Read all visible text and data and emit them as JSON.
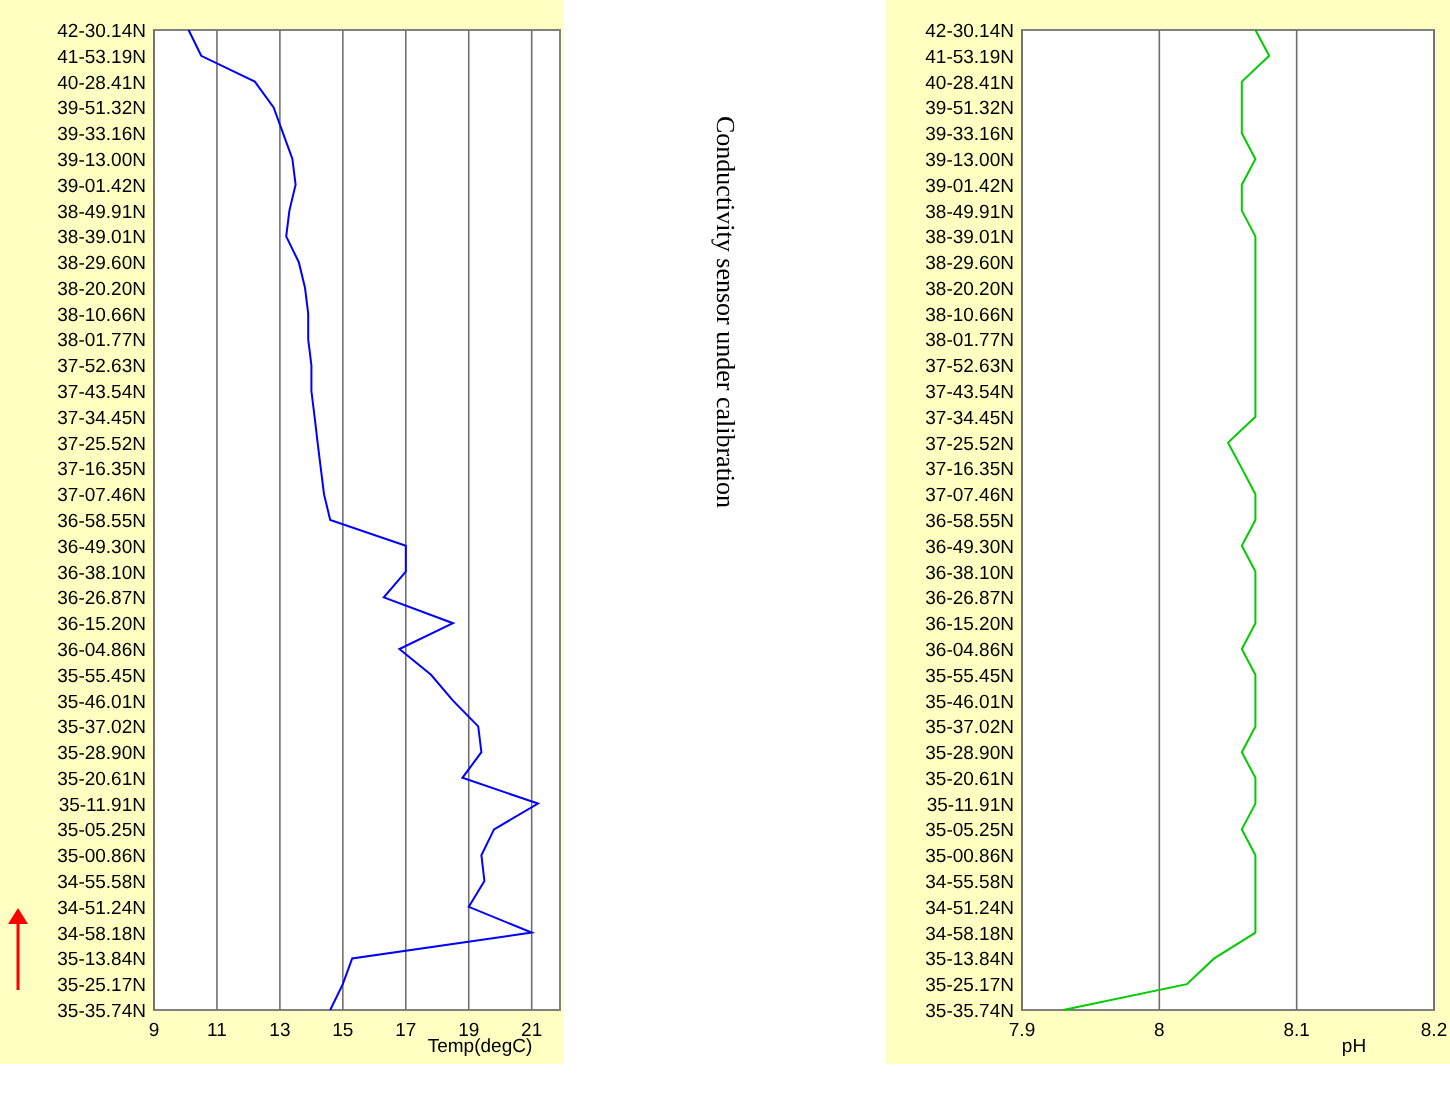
{
  "charts": [
    {
      "chart_data": {
        "type": "line",
        "orientation": "horizontal",
        "xlabel": "Temp(degC)",
        "categories": [
          "42-30.14N",
          "41-53.19N",
          "40-28.41N",
          "39-51.32N",
          "39-33.16N",
          "39-13.00N",
          "39-01.42N",
          "38-49.91N",
          "38-39.01N",
          "38-29.60N",
          "38-20.20N",
          "38-10.66N",
          "38-01.77N",
          "37-52.63N",
          "37-43.54N",
          "37-34.45N",
          "37-25.52N",
          "37-16.35N",
          "37-07.46N",
          "36-58.55N",
          "36-49.30N",
          "36-38.10N",
          "36-26.87N",
          "36-15.20N",
          "36-04.86N",
          "35-55.45N",
          "35-46.01N",
          "35-37.02N",
          "35-28.90N",
          "35-20.61N",
          "35-11.91N",
          "35-05.25N",
          "35-00.86N",
          "34-55.58N",
          "34-51.24N",
          "34-58.18N",
          "35-13.84N",
          "35-25.17N",
          "35-35.74N"
        ],
        "grid": true,
        "series": [
          {
            "color": "#0000ff",
            "values": [
              10.1,
              10.5,
              12.2,
              12.8,
              13.1,
              13.4,
              13.5,
              13.3,
              13.2,
              13.6,
              13.8,
              13.9,
              13.9,
              14.0,
              14.0,
              14.1,
              14.2,
              14.3,
              14.4,
              14.6,
              17.0,
              17.0,
              16.3,
              18.5,
              16.8,
              17.8,
              18.5,
              19.3,
              19.4,
              18.8,
              21.2,
              19.8,
              19.4,
              19.5,
              19.0,
              21.0,
              15.3,
              15.0,
              14.6
            ]
          }
        ],
        "xlim": [
          9,
          21.9
        ],
        "xticks": [
          9,
          11,
          13,
          15,
          17,
          19,
          21
        ]
      }
    },
    {
      "chart_data": {
        "type": "line",
        "orientation": "horizontal",
        "xlabel": "pH",
        "categories": [
          "42-30.14N",
          "41-53.19N",
          "40-28.41N",
          "39-51.32N",
          "39-33.16N",
          "39-13.00N",
          "39-01.42N",
          "38-49.91N",
          "38-39.01N",
          "38-29.60N",
          "38-20.20N",
          "38-10.66N",
          "38-01.77N",
          "37-52.63N",
          "37-43.54N",
          "37-34.45N",
          "37-25.52N",
          "37-16.35N",
          "37-07.46N",
          "36-58.55N",
          "36-49.30N",
          "36-38.10N",
          "36-26.87N",
          "36-15.20N",
          "36-04.86N",
          "35-55.45N",
          "35-46.01N",
          "35-37.02N",
          "35-28.90N",
          "35-20.61N",
          "35-11.91N",
          "35-05.25N",
          "35-00.86N",
          "34-55.58N",
          "34-51.24N",
          "34-58.18N",
          "35-13.84N",
          "35-25.17N",
          "35-35.74N"
        ],
        "grid": true,
        "series": [
          {
            "color": "#00cc00",
            "values": [
              8.07,
              8.08,
              8.06,
              8.06,
              8.06,
              8.07,
              8.06,
              8.06,
              8.07,
              8.07,
              8.07,
              8.07,
              8.07,
              8.07,
              8.07,
              8.07,
              8.05,
              8.06,
              8.07,
              8.07,
              8.06,
              8.07,
              8.07,
              8.07,
              8.06,
              8.07,
              8.07,
              8.07,
              8.06,
              8.07,
              8.07,
              8.06,
              8.07,
              8.07,
              8.07,
              8.07,
              8.04,
              8.02,
              7.93
            ]
          }
        ],
        "xlim": [
          7.9,
          8.2
        ],
        "xticks": [
          7.9,
          8,
          8.1,
          8.2
        ]
      }
    }
  ],
  "caption": "Conductivity sensor under calibration"
}
